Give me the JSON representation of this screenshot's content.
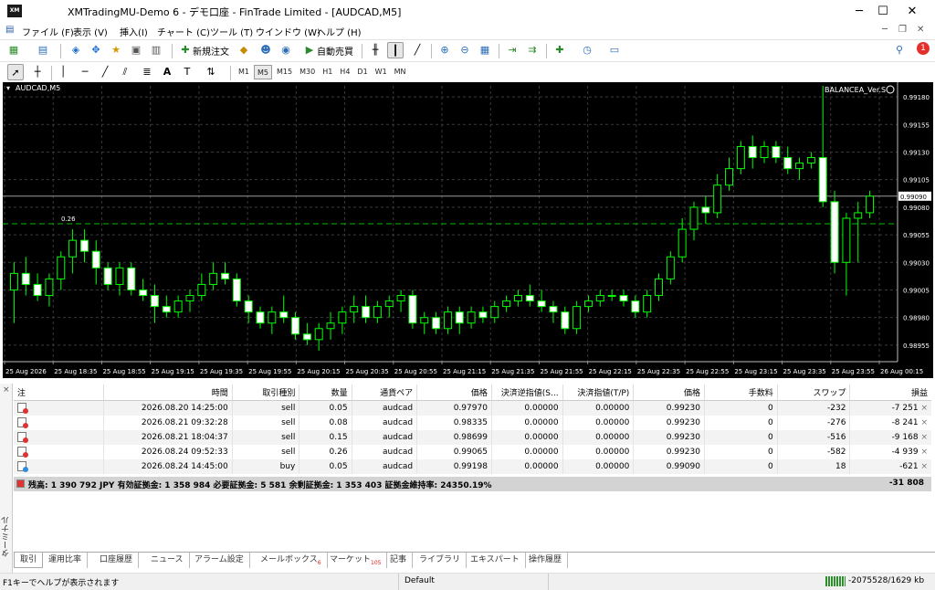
{
  "window": {
    "title": "XMTradingMU-Demo 6 - デモ口座 - FinTrade Limited - [AUDCAD,M5]",
    "app_icon_text": "XM",
    "minimize": "─",
    "maximize": "☐",
    "close": "✕"
  },
  "menu": [
    "ファイル (F)",
    "表示 (V)",
    "挿入(I)",
    "チャート (C)",
    "ツール (T)",
    "ウインドウ (W)",
    "ヘルプ (H)"
  ],
  "notification_count": "1",
  "toolbar": {
    "new_order": "新規注文",
    "autotrade": "自動売買"
  },
  "timeframes": [
    "M1",
    "M5",
    "M15",
    "M30",
    "H1",
    "H4",
    "D1",
    "W1",
    "MN"
  ],
  "active_timeframe": "M5",
  "chart": {
    "symbol_label": "AUDCAD,M5",
    "ea_label": "BALANCEA_Ver.S",
    "order_line_label": "0.26",
    "current_price_label": "0.99090",
    "y_ticks": [
      "0.99180",
      "0.99155",
      "0.99130",
      "0.99105",
      "0.99080",
      "0.99055",
      "0.99030",
      "0.99005",
      "0.98980",
      "0.98955"
    ],
    "x_ticks": [
      "25 Aug 2026",
      "25 Aug 18:35",
      "25 Aug 18:55",
      "25 Aug 19:15",
      "25 Aug 19:35",
      "25 Aug 19:55",
      "25 Aug 20:15",
      "25 Aug 20:35",
      "25 Aug 20:55",
      "25 Aug 21:15",
      "25 Aug 21:35",
      "25 Aug 21:55",
      "25 Aug 22:15",
      "25 Aug 22:35",
      "25 Aug 22:55",
      "25 Aug 23:15",
      "25 Aug 23:35",
      "25 Aug 23:55",
      "26 Aug 00:15"
    ],
    "colors": {
      "background": "#000000",
      "candle": "#00ff00",
      "bull_body": "#000000",
      "bear_body": "#ffffff",
      "grid": "#3a3a3a",
      "text": "#ffffff"
    }
  },
  "chart_data": {
    "type": "candlestick",
    "symbol": "AUDCAD",
    "timeframe": "M5",
    "ylim": [
      0.9894,
      0.9919
    ],
    "current_price": 0.9909,
    "order_line_price": 0.99065,
    "candles": [
      [
        0.99005,
        0.9903,
        0.98975,
        0.9902
      ],
      [
        0.9902,
        0.99035,
        0.99,
        0.9901
      ],
      [
        0.9901,
        0.9902,
        0.98995,
        0.99
      ],
      [
        0.99,
        0.9902,
        0.9899,
        0.99015
      ],
      [
        0.99015,
        0.9904,
        0.99005,
        0.99035
      ],
      [
        0.99035,
        0.9906,
        0.9902,
        0.9905
      ],
      [
        0.9905,
        0.9906,
        0.9903,
        0.9904
      ],
      [
        0.9904,
        0.9905,
        0.9901,
        0.99025
      ],
      [
        0.99025,
        0.9903,
        0.99005,
        0.9901
      ],
      [
        0.9901,
        0.9903,
        0.99,
        0.99025
      ],
      [
        0.99025,
        0.9903,
        0.99,
        0.99005
      ],
      [
        0.99005,
        0.99015,
        0.98995,
        0.99
      ],
      [
        0.99,
        0.9901,
        0.98975,
        0.9899
      ],
      [
        0.9899,
        0.99,
        0.9898,
        0.98985
      ],
      [
        0.98985,
        0.99,
        0.9898,
        0.98995
      ],
      [
        0.98995,
        0.99005,
        0.98985,
        0.99
      ],
      [
        0.99,
        0.9902,
        0.98995,
        0.9901
      ],
      [
        0.9901,
        0.9903,
        0.99005,
        0.9902
      ],
      [
        0.9902,
        0.9903,
        0.9901,
        0.99015
      ],
      [
        0.99015,
        0.9902,
        0.9899,
        0.98995
      ],
      [
        0.98995,
        0.99,
        0.98975,
        0.98985
      ],
      [
        0.98985,
        0.9899,
        0.9897,
        0.98975
      ],
      [
        0.98975,
        0.9899,
        0.98965,
        0.98985
      ],
      [
        0.98985,
        0.99,
        0.98975,
        0.9898
      ],
      [
        0.9898,
        0.98985,
        0.9896,
        0.98965
      ],
      [
        0.98965,
        0.98975,
        0.98955,
        0.9896
      ],
      [
        0.9896,
        0.98975,
        0.9895,
        0.9897
      ],
      [
        0.9897,
        0.98985,
        0.9896,
        0.98975
      ],
      [
        0.98975,
        0.9899,
        0.98965,
        0.98985
      ],
      [
        0.98985,
        0.99,
        0.98975,
        0.9899
      ],
      [
        0.9899,
        0.99,
        0.98975,
        0.9898
      ],
      [
        0.9898,
        0.98995,
        0.98975,
        0.9899
      ],
      [
        0.9899,
        0.99,
        0.9898,
        0.98995
      ],
      [
        0.98995,
        0.99005,
        0.98985,
        0.99
      ],
      [
        0.99,
        0.99005,
        0.9897,
        0.98975
      ],
      [
        0.98975,
        0.98985,
        0.98965,
        0.9898
      ],
      [
        0.9898,
        0.98985,
        0.98965,
        0.9897
      ],
      [
        0.9897,
        0.9899,
        0.98965,
        0.98985
      ],
      [
        0.98985,
        0.9899,
        0.98965,
        0.98975
      ],
      [
        0.98975,
        0.9899,
        0.9897,
        0.98985
      ],
      [
        0.98985,
        0.9899,
        0.98975,
        0.9898
      ],
      [
        0.9898,
        0.98995,
        0.98975,
        0.9899
      ],
      [
        0.9899,
        0.99,
        0.98985,
        0.98995
      ],
      [
        0.98995,
        0.99005,
        0.9899,
        0.99
      ],
      [
        0.99,
        0.9901,
        0.9899,
        0.98995
      ],
      [
        0.98995,
        0.99005,
        0.98985,
        0.9899
      ],
      [
        0.9899,
        0.98995,
        0.98975,
        0.98985
      ],
      [
        0.98985,
        0.9899,
        0.98965,
        0.9897
      ],
      [
        0.9897,
        0.98995,
        0.98965,
        0.9899
      ],
      [
        0.9899,
        0.99,
        0.98985,
        0.98995
      ],
      [
        0.98995,
        0.99005,
        0.9899,
        0.99
      ],
      [
        0.99,
        0.99005,
        0.98995,
        0.99
      ],
      [
        0.99,
        0.99005,
        0.9899,
        0.98995
      ],
      [
        0.98995,
        0.99,
        0.9898,
        0.98985
      ],
      [
        0.98985,
        0.99005,
        0.9898,
        0.99
      ],
      [
        0.99,
        0.9902,
        0.98995,
        0.99015
      ],
      [
        0.99015,
        0.9904,
        0.9901,
        0.99035
      ],
      [
        0.99035,
        0.9907,
        0.9903,
        0.9906
      ],
      [
        0.9906,
        0.99085,
        0.9905,
        0.9908
      ],
      [
        0.9908,
        0.9909,
        0.99065,
        0.99075
      ],
      [
        0.99075,
        0.9911,
        0.9907,
        0.991
      ],
      [
        0.991,
        0.99125,
        0.99095,
        0.99115
      ],
      [
        0.99115,
        0.9914,
        0.9911,
        0.99135
      ],
      [
        0.99135,
        0.99145,
        0.99115,
        0.99125
      ],
      [
        0.99125,
        0.9914,
        0.9912,
        0.99135
      ],
      [
        0.99135,
        0.9914,
        0.9912,
        0.99125
      ],
      [
        0.99125,
        0.99135,
        0.9911,
        0.99115
      ],
      [
        0.99115,
        0.99125,
        0.99105,
        0.9912
      ],
      [
        0.9912,
        0.9913,
        0.99115,
        0.99125
      ],
      [
        0.99125,
        0.9919,
        0.9908,
        0.99085
      ],
      [
        0.99085,
        0.99095,
        0.9902,
        0.9903
      ],
      [
        0.9903,
        0.99075,
        0.99,
        0.9907
      ],
      [
        0.9907,
        0.99085,
        0.9903,
        0.99075
      ],
      [
        0.99075,
        0.99095,
        0.9907,
        0.9909
      ]
    ]
  },
  "terminal": {
    "side_label": "ターミナル",
    "close": "×",
    "columns": [
      "注",
      "時間",
      "取引種別",
      "数量",
      "通貨ペア",
      "価格",
      "決済逆指値(S...",
      "決済指値(T/P)",
      "価格",
      "手数料",
      "スワップ",
      "損益"
    ],
    "rows": [
      {
        "type_icon": "sell",
        "time": "2026.08.20 14:25:00",
        "side": "sell",
        "volume": "0.05",
        "symbol": "audcad",
        "open_price": "0.97970",
        "sl": "0.00000",
        "tp": "0.00000",
        "price": "0.99230",
        "commission": "0",
        "swap": "-232",
        "profit": "-7 251"
      },
      {
        "type_icon": "sell",
        "time": "2026.08.21 09:32:28",
        "side": "sell",
        "volume": "0.08",
        "symbol": "audcad",
        "open_price": "0.98335",
        "sl": "0.00000",
        "tp": "0.00000",
        "price": "0.99230",
        "commission": "0",
        "swap": "-276",
        "profit": "-8 241"
      },
      {
        "type_icon": "sell",
        "time": "2026.08.21 18:04:37",
        "side": "sell",
        "volume": "0.15",
        "symbol": "audcad",
        "open_price": "0.98699",
        "sl": "0.00000",
        "tp": "0.00000",
        "price": "0.99230",
        "commission": "0",
        "swap": "-516",
        "profit": "-9 168"
      },
      {
        "type_icon": "sell",
        "time": "2026.08.24 09:52:33",
        "side": "sell",
        "volume": "0.26",
        "symbol": "audcad",
        "open_price": "0.99065",
        "sl": "0.00000",
        "tp": "0.00000",
        "price": "0.99230",
        "commission": "0",
        "swap": "-582",
        "profit": "-4 939"
      },
      {
        "type_icon": "buy",
        "time": "2026.08.24 14:45:00",
        "side": "buy",
        "volume": "0.05",
        "symbol": "audcad",
        "open_price": "0.99198",
        "sl": "0.00000",
        "tp": "0.00000",
        "price": "0.99090",
        "commission": "0",
        "swap": "18",
        "profit": "-621"
      }
    ],
    "summary": "残高: 1 390 792 JPY  有効証拠金: 1 358 984  必要証拠金: 5 581  余剰証拠金: 1 353 403  証拠金維持率: 24350.19%",
    "summary_total": "-31 808",
    "tabs": [
      {
        "label": "取引",
        "badge": ""
      },
      {
        "label": "運用比率",
        "badge": ""
      },
      {
        "label": "口座履歴",
        "badge": ""
      },
      {
        "label": "ニュース",
        "badge": ""
      },
      {
        "label": "アラーム設定",
        "badge": ""
      },
      {
        "label": "メールボックス",
        "badge": "6"
      },
      {
        "label": "マーケット",
        "badge": "105"
      },
      {
        "label": "記事",
        "badge": ""
      },
      {
        "label": "ライブラリ",
        "badge": ""
      },
      {
        "label": "エキスパート",
        "badge": ""
      },
      {
        "label": "操作履歴",
        "badge": ""
      }
    ]
  },
  "status": {
    "help": "F1キーでヘルプが表示されます",
    "profile": "Default",
    "traffic": "-2075528/1629 kb"
  }
}
